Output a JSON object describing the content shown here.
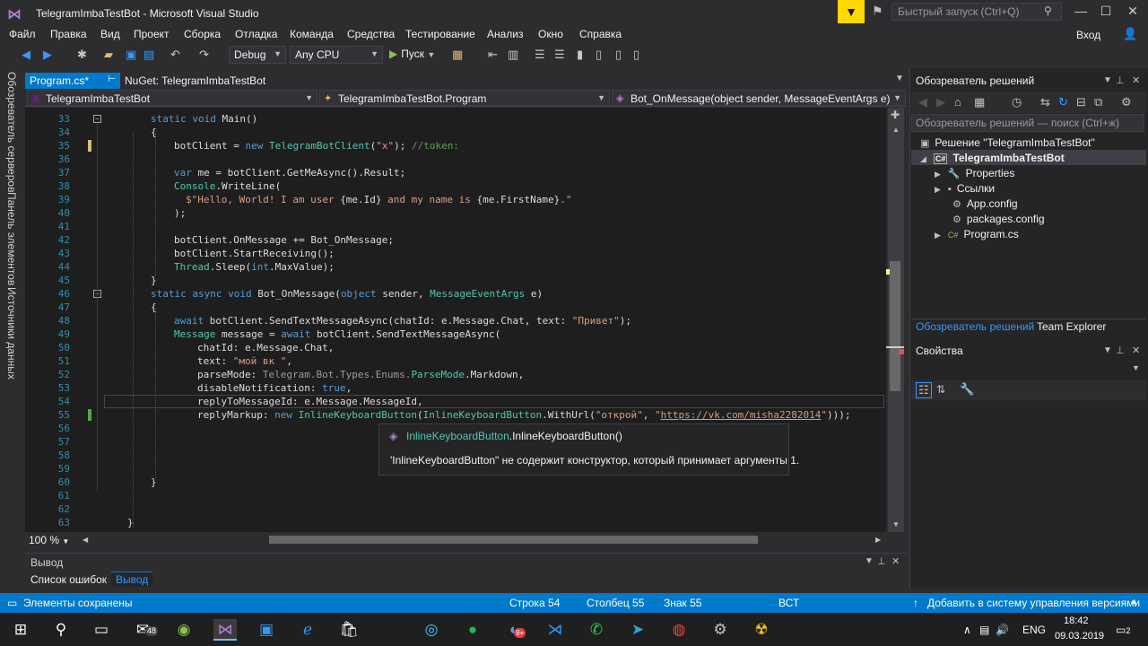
{
  "window": {
    "title": "TelegramImbaTestBot - Microsoft Visual Studio",
    "quick_launch_placeholder": "Быстрый запуск (Ctrl+Q)",
    "login": "Вход"
  },
  "menu": [
    "Файл",
    "Правка",
    "Вид",
    "Проект",
    "Сборка",
    "Отладка",
    "Команда",
    "Средства",
    "Тестирование",
    "Анализ",
    "Окно",
    "Справка"
  ],
  "toolbar": {
    "config": "Debug",
    "platform": "Any CPU",
    "run_label": "Пуск"
  },
  "left_tabs": [
    "Обозреватель серверов",
    "Панель элементов",
    "Источники данных"
  ],
  "doc_tabs": {
    "active": "Program.cs*",
    "other": "NuGet: TelegramImbaTestBot"
  },
  "navbar": {
    "project": "TelegramImbaTestBot",
    "class": "TelegramImbaTestBot.Program",
    "member": "Bot_OnMessage(object sender, MessageEventArgs e)"
  },
  "line_numbers": [
    "33",
    "34",
    "35",
    "36",
    "37",
    "38",
    "39",
    "40",
    "41",
    "42",
    "43",
    "44",
    "45",
    "46",
    "47",
    "48",
    "49",
    "50",
    "51",
    "52",
    "53",
    "54",
    "55",
    "56",
    "57",
    "58",
    "59",
    "60",
    "61",
    "62",
    "63"
  ],
  "code": {
    "l33_kw": "static void",
    "l33_rest": " Main()",
    "l34": "{",
    "l35_a": "botClient = ",
    "l35_kw": "new",
    "l35_ty": " TelegramBotClient",
    "l35_b": "(",
    "l35_str": "\"x\"",
    "l35_c": "); ",
    "l35_cm": "//token:",
    "l37_kw": "var",
    "l37_rest": " me = botClient.GetMeAsync().Result;",
    "l38_ty": "Console",
    "l38_rest": ".WriteLine(",
    "l39_str": "$\"Hello, World! I am user ",
    "l39_a": "{me.Id}",
    "l39_str2": " and my name is ",
    "l39_b": "{me.FirstName}",
    "l39_str3": ".\"",
    "l40": ");",
    "l42": "botClient.OnMessage += Bot_OnMessage;",
    "l43": "botClient.StartReceiving();",
    "l44_ty": "Thread",
    "l44_a": ".Sleep(",
    "l44_kw": "int",
    "l44_b": ".MaxValue);",
    "l45": "}",
    "l46_kw": "static async void",
    "l46_a": " Bot_OnMessage(",
    "l46_kw2": "object",
    "l46_b": " sender, ",
    "l46_ty": "MessageEventArgs",
    "l46_c": " e)",
    "l47": "{",
    "l48_kw": "await",
    "l48_a": " botClient.SendTextMessageAsync(chatId: e.Message.Chat, text: ",
    "l48_str": "\"Привет\"",
    "l48_b": ");",
    "l49_ty": "Message",
    "l49_a": " message = ",
    "l49_kw": "await",
    "l49_b": " botClient.SendTextMessageAsync(",
    "l50": "chatId: e.Message.Chat,",
    "l51_a": "text: ",
    "l51_str": "\"мой вк \"",
    "l51_b": ",",
    "l52_a": "parseMode: ",
    "l52_gr": "Telegram.Bot.Types.Enums.",
    "l52_ty": "ParseMode",
    "l52_b": ".Markdown,",
    "l53_a": "disableNotification: ",
    "l53_kw": "true",
    "l53_b": ",",
    "l54": "replyToMessageId: e.Message.MessageId,",
    "l55_a": "replyMarkup: ",
    "l55_kw": "new",
    "l55_ty": " InlineKeyboardButton",
    "l55_b": "(",
    "l55_ty2": "InlineKeyboardButton",
    "l55_c": ".WithUrl(",
    "l55_str": "\"открой\"",
    "l55_d": ", ",
    "l55_str2a": "\"",
    "l55_url": "https://vk.com/misha2282014",
    "l55_str2b": "\"",
    "l55_e": ")));",
    "l60": "}",
    "l63": "}"
  },
  "tooltip": {
    "signature_type": "InlineKeyboardButton",
    "signature_rest": ".InlineKeyboardButton()",
    "message": "'InlineKeyboardButton\" не содержит конструктор, который принимает аргументы 1."
  },
  "editor": {
    "zoom": "100 %"
  },
  "output": {
    "title": "Вывод",
    "tab_errors": "Список ошибок",
    "tab_output": "Вывод"
  },
  "solution_explorer": {
    "title": "Обозреватель решений",
    "search_placeholder": "Обозреватель решений — поиск (Ctrl+ж)",
    "tree": {
      "solution": "Решение \"TelegramImbaTestBot\"  (проектов:",
      "project": "TelegramImbaTestBot",
      "project_icon": "C#",
      "items": [
        "Properties",
        "Ссылки",
        "App.config",
        "packages.config",
        "Program.cs"
      ],
      "program_icon": "C#"
    },
    "tab1": "Обозреватель решений",
    "tab2": "Team Explorer"
  },
  "properties": {
    "title": "Свойства"
  },
  "status": {
    "message": "Элементы сохранены",
    "row": "Строка 54",
    "col": "Столбец 55",
    "ch": "Знак 55",
    "mode": "ВСТ",
    "vcs": "Добавить в систему управления версиями"
  },
  "taskbar": {
    "mail_badge": "48",
    "discord_badge": "9+",
    "lang": "ENG",
    "time": "18:42",
    "date": "09.03.2019",
    "notif_count": "2"
  },
  "colors": {
    "accent": "#007acc",
    "editor_bg": "#1e1e1e",
    "keyword": "#569cd6",
    "type": "#4ec9b0",
    "string": "#d69d85",
    "comment": "#57a64a",
    "line_number": "#2b91af"
  }
}
